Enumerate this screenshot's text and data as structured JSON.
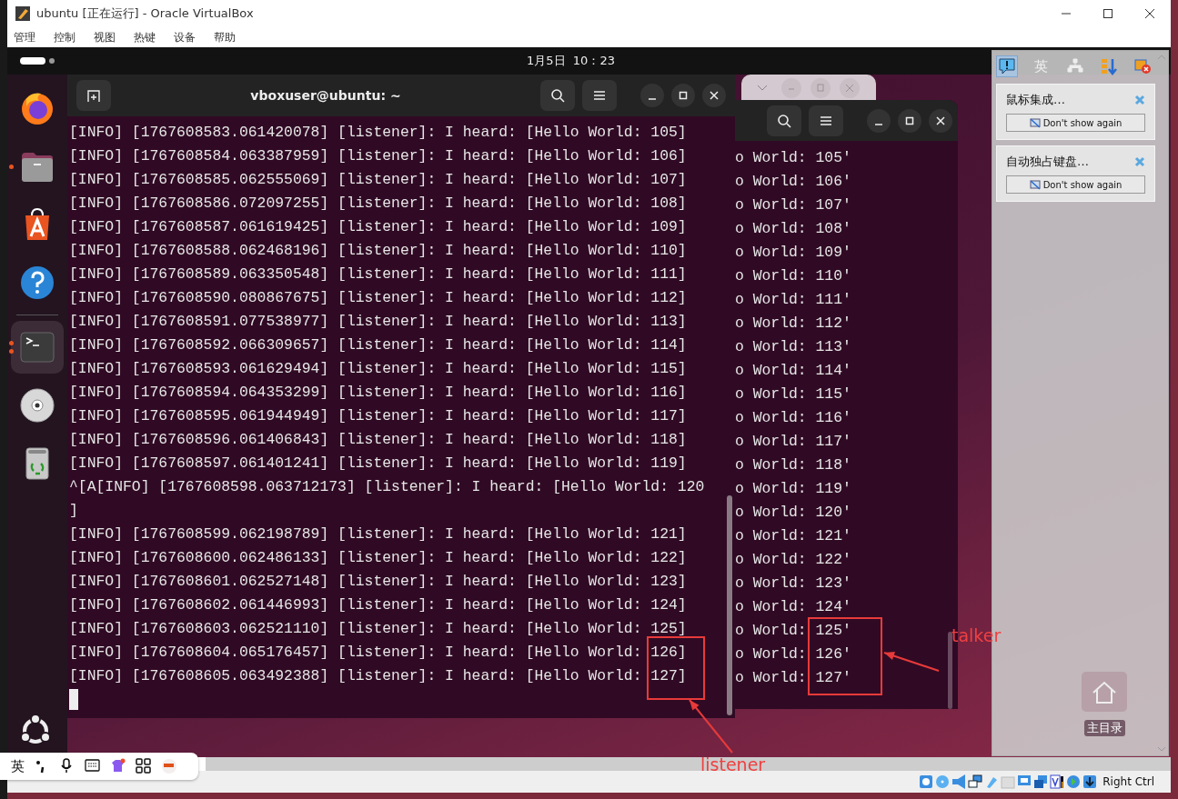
{
  "window": {
    "title": "ubuntu [正在运行] - Oracle VirtualBox"
  },
  "menu": [
    "管理",
    "控制",
    "视图",
    "热键",
    "设备",
    "帮助"
  ],
  "top_bar": {
    "clock": "1月5日  10：23"
  },
  "dock": {
    "items": [
      {
        "kind": "browser",
        "running": false,
        "multiple_windows": false,
        "selected": false
      },
      {
        "kind": "files",
        "running": true,
        "multiple_windows": false,
        "selected": false
      },
      {
        "kind": "store",
        "running": false,
        "multiple_windows": false,
        "selected": false
      },
      {
        "kind": "help",
        "running": false,
        "multiple_windows": false,
        "selected": false
      },
      {
        "kind": "terminal",
        "running": true,
        "multiple_windows": true,
        "selected": true
      },
      {
        "kind": "disc",
        "running": false,
        "multiple_windows": false,
        "selected": false
      },
      {
        "kind": "trash",
        "running": false,
        "multiple_windows": false,
        "selected": false
      }
    ]
  },
  "terminal": {
    "title": "vboxuser@ubuntu: ~",
    "cursor": true,
    "lines": [
      "[INFO] [1767608583.061420078] [listener]: I heard: [Hello World: 105]",
      "[INFO] [1767608584.063387959] [listener]: I heard: [Hello World: 106]",
      "[INFO] [1767608585.062555069] [listener]: I heard: [Hello World: 107]",
      "[INFO] [1767608586.072097255] [listener]: I heard: [Hello World: 108]",
      "[INFO] [1767608587.061619425] [listener]: I heard: [Hello World: 109]",
      "[INFO] [1767608588.062468196] [listener]: I heard: [Hello World: 110]",
      "[INFO] [1767608589.063350548] [listener]: I heard: [Hello World: 111]",
      "[INFO] [1767608590.080867675] [listener]: I heard: [Hello World: 112]",
      "[INFO] [1767608591.077538977] [listener]: I heard: [Hello World: 113]",
      "[INFO] [1767608592.066309657] [listener]: I heard: [Hello World: 114]",
      "[INFO] [1767608593.061629494] [listener]: I heard: [Hello World: 115]",
      "[INFO] [1767608594.064353299] [listener]: I heard: [Hello World: 116]",
      "[INFO] [1767608595.061944949] [listener]: I heard: [Hello World: 117]",
      "[INFO] [1767608596.061406843] [listener]: I heard: [Hello World: 118]",
      "[INFO] [1767608597.061401241] [listener]: I heard: [Hello World: 119]",
      "^[A[INFO] [1767608598.063712173] [listener]: I heard: [Hello World: 120",
      "]",
      "[INFO] [1767608599.062198789] [listener]: I heard: [Hello World: 121]",
      "[INFO] [1767608600.062486133] [listener]: I heard: [Hello World: 122]",
      "[INFO] [1767608601.062527148] [listener]: I heard: [Hello World: 123]",
      "[INFO] [1767608602.061446993] [listener]: I heard: [Hello World: 124]",
      "[INFO] [1767608603.062521110] [listener]: I heard: [Hello World: 125]",
      "[INFO] [1767608604.065176457] [listener]: I heard: [Hello World: 126]",
      "[INFO] [1767608605.063492388] [listener]: I heard: [Hello World: 127]"
    ]
  },
  "back_terminal": {
    "lines": [
      "o World: 105'",
      "o World: 106'",
      "o World: 107'",
      "o World: 108'",
      "o World: 109'",
      "o World: 110'",
      "o World: 111'",
      "o World: 112'",
      "o World: 113'",
      "o World: 114'",
      "o World: 115'",
      "o World: 116'",
      "o World: 117'",
      "o World: 118'",
      "o World: 119'",
      "o World: 120'",
      "o World: 121'",
      "o World: 122'",
      "o World: 123'",
      "o World: 124'",
      "o World: 125'",
      "o World: 126'",
      "o World: 127'"
    ]
  },
  "notifications": {
    "tabs": [
      {
        "kind": "info",
        "selected": true
      },
      {
        "kind": "language",
        "label": "英",
        "selected": false
      },
      {
        "kind": "network",
        "selected": false
      },
      {
        "kind": "sort",
        "selected": false
      },
      {
        "kind": "error",
        "selected": false
      }
    ],
    "items": [
      {
        "text": "鼠标集成…",
        "button": "Don't show again"
      },
      {
        "text": "自动独占键盘…",
        "button": "Don't show again"
      }
    ]
  },
  "desktop_icons": [
    {
      "label": "主目录"
    }
  ],
  "input_toolbar": {
    "mode": "英"
  },
  "status_bar": {
    "host_key": "Right Ctrl"
  },
  "annotations": [
    {
      "label": "talker"
    },
    {
      "label": "listener"
    }
  ]
}
